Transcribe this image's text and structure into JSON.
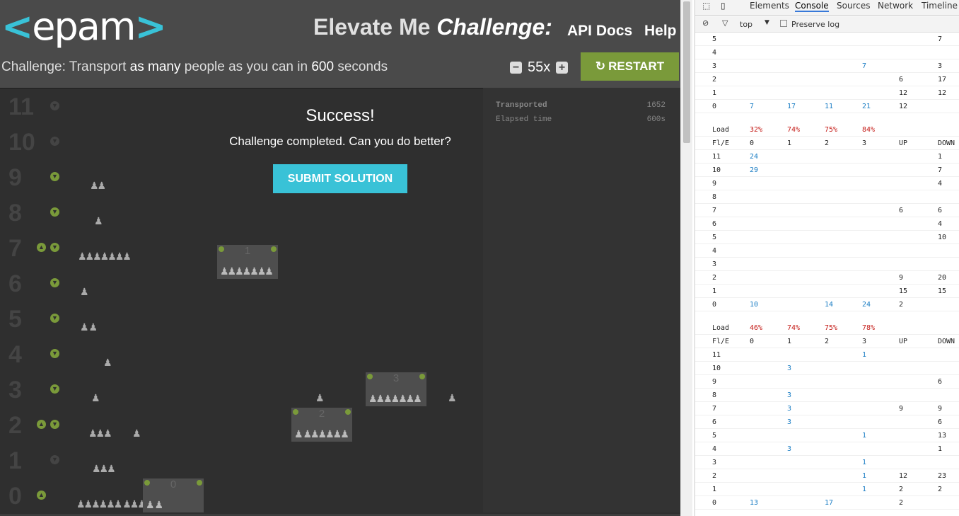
{
  "header": {
    "logo": "epam",
    "title_main": "Elevate Me",
    "title_em": "Challenge:",
    "nav": [
      "API Docs",
      "Help"
    ]
  },
  "challenge": {
    "prefix": "Challenge: Transport ",
    "em1": "as many",
    "mid": " people as you can in ",
    "em2": "600",
    "suffix": " seconds"
  },
  "controls": {
    "speed": "55x",
    "restart": "RESTART",
    "minus": "−",
    "plus": "+"
  },
  "stats": [
    {
      "label": "Transported",
      "value": "1652"
    },
    {
      "label": "Elapsed time",
      "value": "600s"
    }
  ],
  "success": {
    "title": "Success!",
    "message": "Challenge completed. Can you do better?",
    "submit": "SUBMIT SOLUTION"
  },
  "floors": [
    "11",
    "10",
    "9",
    "8",
    "7",
    "6",
    "5",
    "4",
    "3",
    "2",
    "1",
    "0"
  ],
  "elevators": [
    {
      "label": "0"
    },
    {
      "label": "1"
    },
    {
      "label": "2"
    },
    {
      "label": "3"
    }
  ],
  "devtools": {
    "tabs": [
      "Elements",
      "Console",
      "Sources",
      "Network",
      "Timeline"
    ],
    "context": "top",
    "preserve_log": "Preserve log"
  },
  "console": {
    "block1": [
      [
        "5",
        "",
        "",
        "",
        "",
        "",
        "7"
      ],
      [
        "4",
        "",
        "",
        "",
        "",
        "",
        ""
      ],
      [
        "3",
        "",
        "",
        "",
        "7",
        "",
        "3"
      ],
      [
        "2",
        "",
        "",
        "",
        "",
        "6",
        "17"
      ],
      [
        "1",
        "",
        "",
        "",
        "",
        "12",
        "12"
      ],
      [
        "0",
        "7",
        "17",
        "11",
        "21",
        "12",
        ""
      ]
    ],
    "block2_load": [
      "Load",
      "32%",
      "74%",
      "75%",
      "84%"
    ],
    "block2_head": [
      "Fl/E",
      "0",
      "1",
      "2",
      "3",
      "UP",
      "DOWN"
    ],
    "block2": [
      [
        "11",
        "24",
        "",
        "",
        "",
        "",
        "1"
      ],
      [
        "10",
        "29",
        "",
        "",
        "",
        "",
        "7"
      ],
      [
        "9",
        "",
        "",
        "",
        "",
        "",
        "4"
      ],
      [
        "8",
        "",
        "",
        "",
        "",
        "",
        ""
      ],
      [
        "7",
        "",
        "",
        "",
        "",
        "6",
        "6"
      ],
      [
        "6",
        "",
        "",
        "",
        "",
        "",
        "4"
      ],
      [
        "5",
        "",
        "",
        "",
        "",
        "",
        "10"
      ],
      [
        "4",
        "",
        "",
        "",
        "",
        "",
        ""
      ],
      [
        "3",
        "",
        "",
        "",
        "",
        "",
        ""
      ],
      [
        "2",
        "",
        "",
        "",
        "",
        "9",
        "20"
      ],
      [
        "1",
        "",
        "",
        "",
        "",
        "15",
        "15"
      ],
      [
        "0",
        "10",
        "",
        "14",
        "24",
        "2",
        ""
      ]
    ],
    "block3_load": [
      "Load",
      "46%",
      "74%",
      "75%",
      "78%"
    ],
    "block3_head": [
      "Fl/E",
      "0",
      "1",
      "2",
      "3",
      "UP",
      "DOWN"
    ],
    "block3": [
      [
        "11",
        "",
        "",
        "",
        "1",
        "",
        ""
      ],
      [
        "10",
        "",
        "3",
        "",
        "",
        "",
        ""
      ],
      [
        "9",
        "",
        "",
        "",
        "",
        "",
        "6"
      ],
      [
        "8",
        "",
        "3",
        "",
        "",
        "",
        ""
      ],
      [
        "7",
        "",
        "3",
        "",
        "",
        "9",
        "9"
      ],
      [
        "6",
        "",
        "3",
        "",
        "",
        "",
        "6"
      ],
      [
        "5",
        "",
        "",
        "",
        "1",
        "",
        "13"
      ],
      [
        "4",
        "",
        "3",
        "",
        "",
        "",
        "1"
      ],
      [
        "3",
        "",
        "",
        "",
        "1",
        "",
        ""
      ],
      [
        "2",
        "",
        "",
        "",
        "1",
        "12",
        "23"
      ],
      [
        "1",
        "",
        "",
        "",
        "1",
        "2",
        "2"
      ],
      [
        "0",
        "13",
        "",
        "17",
        "",
        "2",
        ""
      ]
    ]
  }
}
